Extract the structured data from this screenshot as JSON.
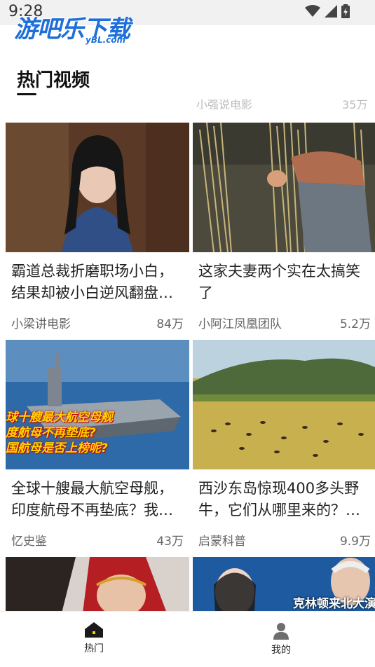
{
  "status_bar": {
    "time": "9:28"
  },
  "watermark": {
    "text": "游吧乐下载",
    "sub": "yBL.com"
  },
  "header": {
    "title": "热门视频"
  },
  "cut_row": {
    "left": "小强说电影",
    "right": "35万"
  },
  "videos": [
    {
      "title": "霸道总裁折磨职场小白，结果却被小白逆风翻盘…",
      "author": "小梁讲电影",
      "views": "84万"
    },
    {
      "title": "这家夫妻两个实在太搞笑了",
      "author": "小阿江凤凰团队",
      "views": "5.2万"
    },
    {
      "title": "全球十艘最大航空母舰，印度航母不再垫底？我…",
      "author": "忆史鉴",
      "views": "43万",
      "overlay": [
        "球十艘最大航空母舰",
        "度航母不再垫底?",
        "国航母是否上榜呢?"
      ]
    },
    {
      "title": "西沙东岛惊现400多头野牛，它们从哪里来的？…",
      "author": "启蒙科普",
      "views": "9.9万"
    },
    {
      "title": "",
      "author": "",
      "views": ""
    },
    {
      "title": "",
      "author": "",
      "views": "",
      "overlay": [
        "克林顿来北大演"
      ]
    }
  ],
  "bottom_nav": {
    "items": [
      {
        "label": "热门",
        "icon": "home-icon"
      },
      {
        "label": "我的",
        "icon": "person-icon"
      }
    ]
  }
}
